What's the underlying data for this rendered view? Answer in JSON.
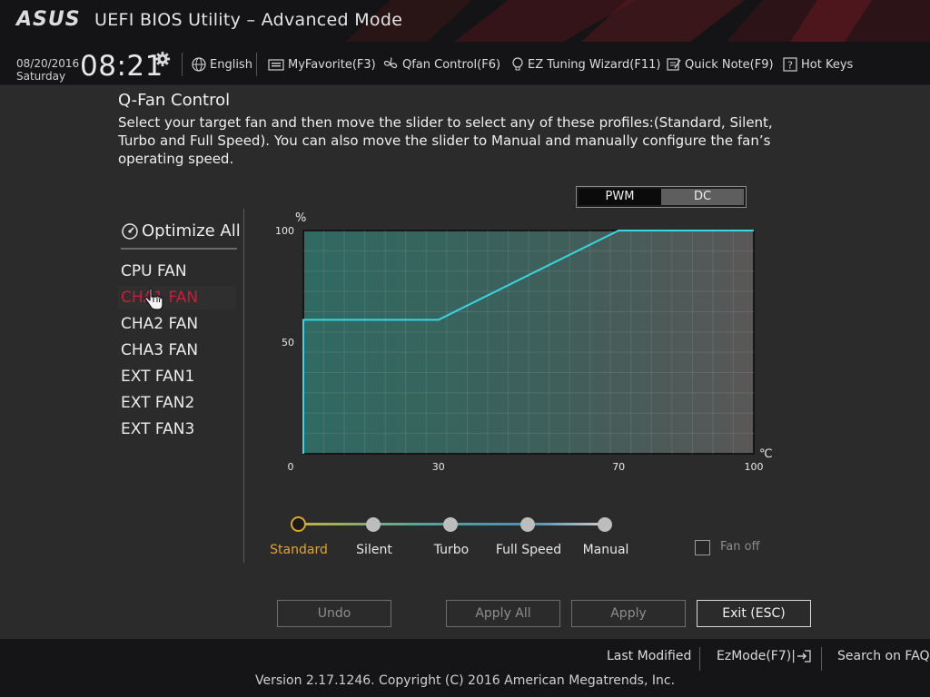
{
  "window": {
    "logo": "ASUS",
    "title": "UEFI BIOS Utility – Advanced Mode"
  },
  "toolbar": {
    "date": "08/20/2016",
    "day": "Saturday",
    "time": "08:21",
    "items": [
      {
        "label": "English",
        "icon": "globe-icon"
      },
      {
        "label": "MyFavorite(F3)",
        "icon": "favorite-folder-icon"
      },
      {
        "label": "Qfan Control(F6)",
        "icon": "fan-icon"
      },
      {
        "label": "EZ Tuning Wizard(F11)",
        "icon": "lightbulb-icon"
      },
      {
        "label": "Quick Note(F9)",
        "icon": "note-icon"
      },
      {
        "label": "Hot Keys",
        "icon": "question-icon"
      }
    ]
  },
  "page": {
    "title": "Q-Fan Control",
    "description": "Select your target fan and then move the slider to select any of these profiles:(Standard, Silent, Turbo and Full Speed). You can also move the slider to Manual and manually configure the fan’s operating speed."
  },
  "fans": {
    "optimize_label": "Optimize All",
    "selected": "CHA1 FAN",
    "items": [
      "CPU FAN",
      "CHA1 FAN",
      "CHA2 FAN",
      "CHA3 FAN",
      "EXT FAN1",
      "EXT FAN2",
      "EXT FAN3"
    ]
  },
  "mode_toggle": {
    "options": [
      "PWM",
      "DC"
    ],
    "selected": "PWM"
  },
  "chart_data": {
    "type": "line",
    "ylabel": "%",
    "xlabel": "℃",
    "xlim": [
      0,
      100
    ],
    "ylim": [
      0,
      100
    ],
    "x_ticks": [
      "0",
      "30",
      "70",
      "100"
    ],
    "y_ticks": [
      "100",
      "50"
    ],
    "grid": true,
    "series": [
      {
        "color": "#37d6e6",
        "points": [
          [
            0,
            0
          ],
          [
            0,
            60
          ],
          [
            30,
            60
          ],
          [
            70,
            100
          ],
          [
            100,
            100
          ]
        ]
      }
    ]
  },
  "profiles": {
    "items": [
      "Standard",
      "Silent",
      "Turbo",
      "Full Speed",
      "Manual"
    ],
    "selected": "Standard"
  },
  "fan_off": {
    "label": "Fan off",
    "checked": false
  },
  "buttons": {
    "undo": "Undo",
    "apply_all": "Apply All",
    "apply": "Apply",
    "exit": "Exit (ESC)"
  },
  "footer": {
    "last_modified": "Last Modified",
    "ezmode": "EzMode(F7)|",
    "search": "Search on FAQ",
    "copyright": "Version 2.17.1246. Copyright (C) 2016 American Megatrends, Inc."
  },
  "colors": {
    "accent_selected": "#d11a3a",
    "profile_active": "#e0a52a",
    "curve": "#37d6e6"
  }
}
